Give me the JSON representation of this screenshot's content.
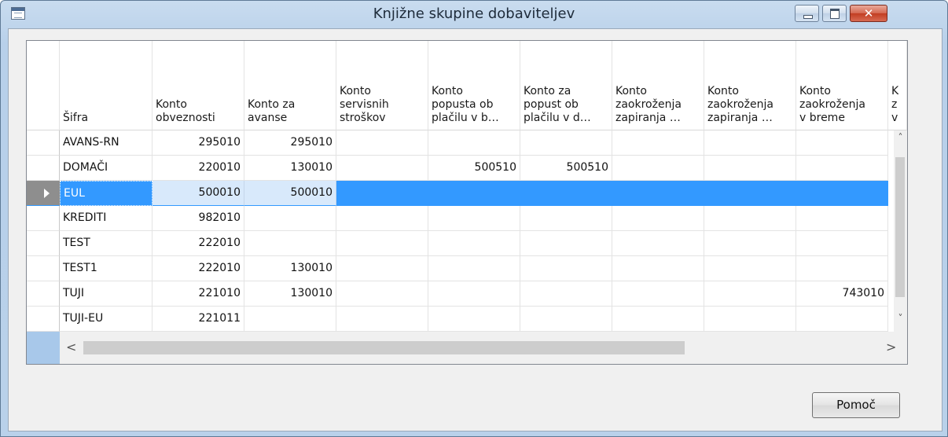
{
  "window": {
    "title": "Knjižne skupine dobaviteljev",
    "close_glyph": "✕",
    "icons": [
      "table-icon",
      "minimize-icon",
      "maximize-icon",
      "close-icon"
    ]
  },
  "grid": {
    "columns": [
      "Šifra",
      "Konto\nobveznosti",
      "Konto za\navanse",
      "Konto\nservisnih\nstroškov",
      "Konto\npopusta ob\nplačilu v b…",
      "Konto za\npopust ob\nplačilu v d…",
      "Konto\nzaokroženja\nzapiranja …",
      "Konto\nzaokroženja\nzapiranja …",
      "Konto\nzaokroženja\nv breme",
      "K\nz\nv"
    ],
    "rows": [
      [
        "AVANS-RN",
        "295010",
        "295010",
        "",
        "",
        "",
        "",
        "",
        ""
      ],
      [
        "DOMAČI",
        "220010",
        "130010",
        "",
        "500510",
        "500510",
        "",
        "",
        ""
      ],
      [
        "EUL",
        "500010",
        "500010",
        "",
        "",
        "",
        "",
        "",
        ""
      ],
      [
        "KREDITI",
        "982010",
        "",
        "",
        "",
        "",
        "",
        "",
        ""
      ],
      [
        "TEST",
        "222010",
        "",
        "",
        "",
        "",
        "",
        "",
        ""
      ],
      [
        "TEST1",
        "222010",
        "130010",
        "",
        "",
        "",
        "",
        "",
        ""
      ],
      [
        "TUJI",
        "221010",
        "130010",
        "",
        "",
        "",
        "",
        "",
        "743010"
      ],
      [
        "TUJI-EU",
        "221011",
        "",
        "",
        "",
        "",
        "",
        "",
        ""
      ]
    ],
    "selected_row": 2,
    "scroll": {
      "up": "˄",
      "down": "˅",
      "left": "<",
      "right": ">"
    }
  },
  "buttons": {
    "help": "Pomoč"
  },
  "colors": {
    "selection": "#3399ff",
    "title_bar": "#b9d1ea",
    "close_button": "#c23d22"
  }
}
